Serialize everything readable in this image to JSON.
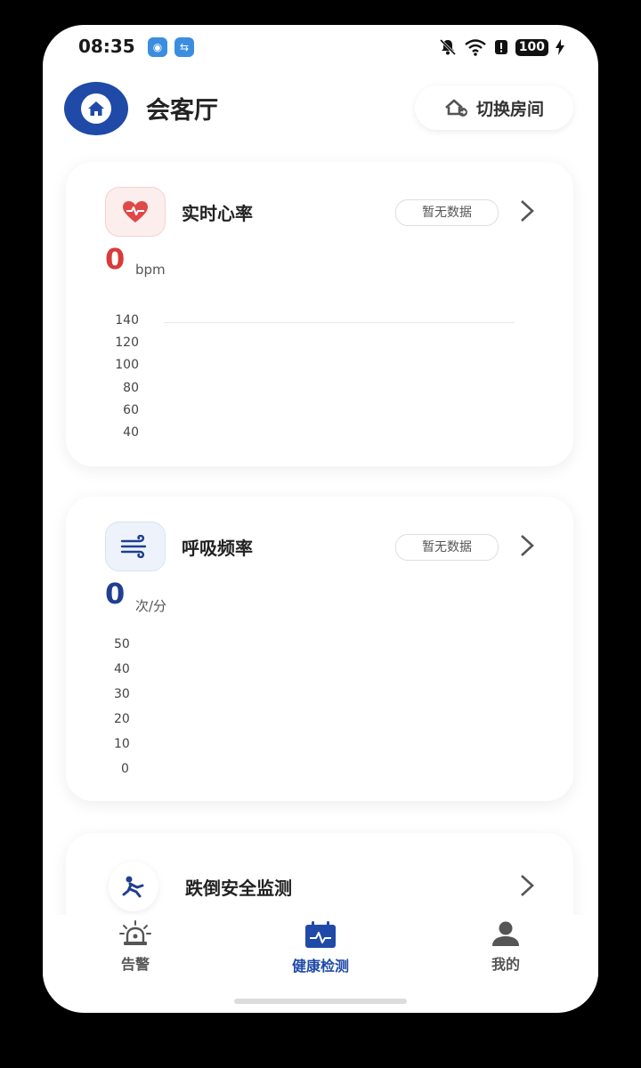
{
  "status_bar": {
    "time": "08:35",
    "battery": "100"
  },
  "header": {
    "room_name": "会客厅",
    "switch_room_label": "切换房间"
  },
  "heart_card": {
    "title": "实时心率",
    "status": "暂无数据",
    "value": "0",
    "unit": "bpm",
    "accent": "#d93a3a",
    "y_ticks": [
      "140",
      "120",
      "100",
      "80",
      "60",
      "40"
    ]
  },
  "breath_card": {
    "title": "呼吸频率",
    "status": "暂无数据",
    "value": "0",
    "unit": "次/分",
    "accent": "#1f3f8f",
    "y_ticks": [
      "50",
      "40",
      "30",
      "20",
      "10",
      "0"
    ]
  },
  "fall_card": {
    "title": "跌倒安全监测"
  },
  "tabs": [
    {
      "label": "告警",
      "icon": "alarm-light-icon",
      "active": false
    },
    {
      "label": "健康检测",
      "icon": "health-calendar-icon",
      "active": true
    },
    {
      "label": "我的",
      "icon": "person-icon",
      "active": false
    }
  ],
  "colors": {
    "primary": "#1f4aa8",
    "active_tab": "#1f4aa8",
    "inactive_tab": "#555555"
  }
}
